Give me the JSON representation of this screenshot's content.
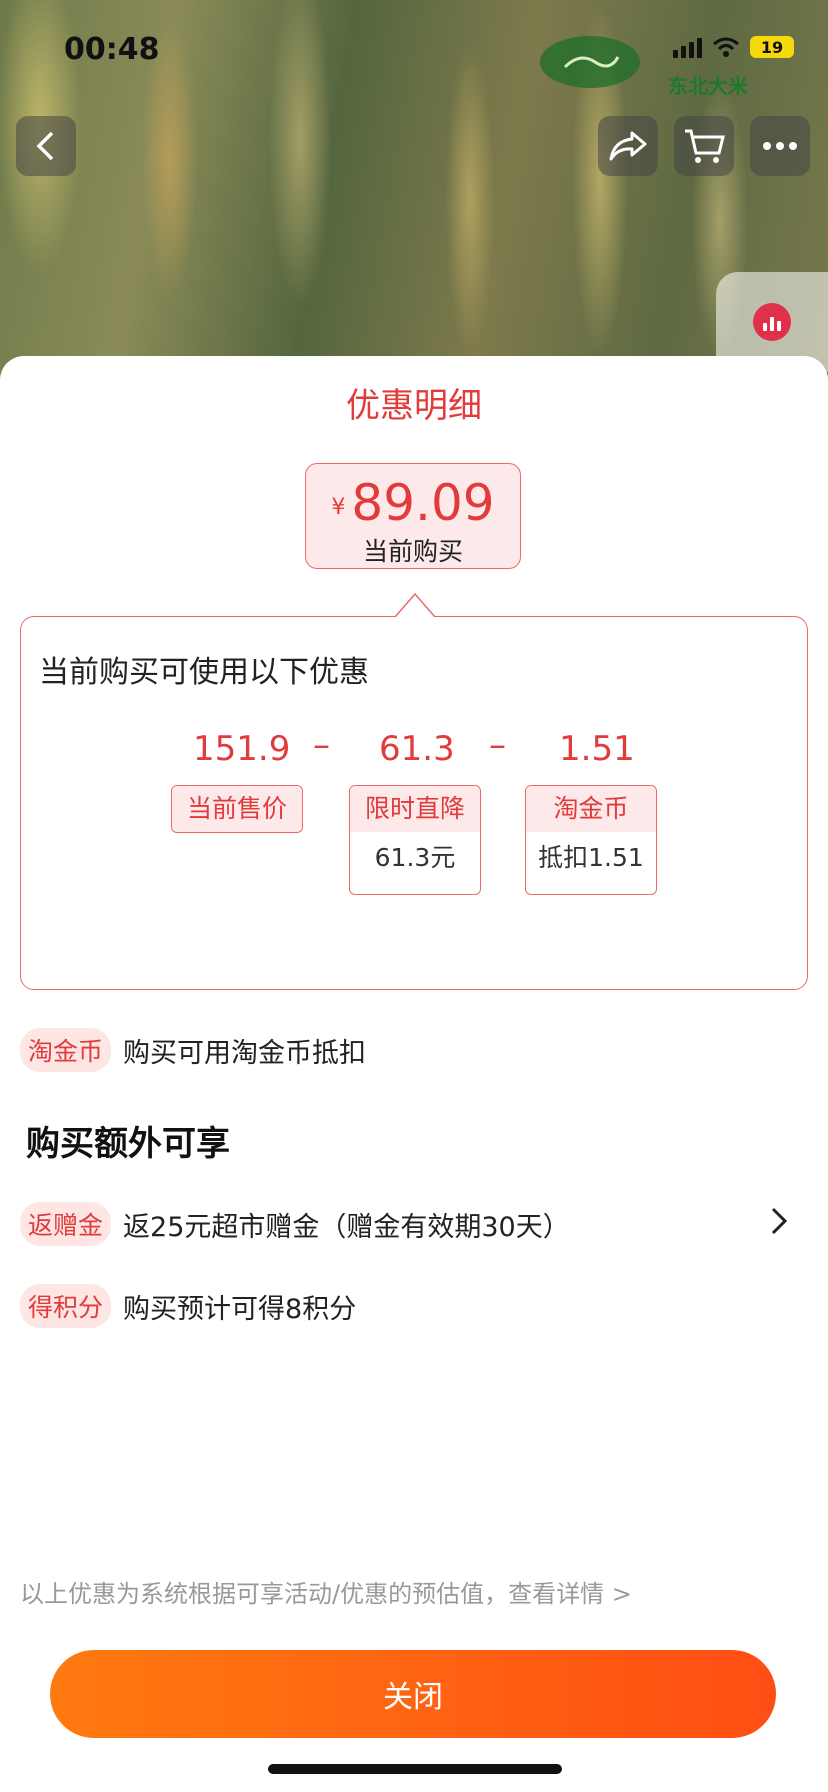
{
  "status_bar": {
    "time": "00:48",
    "battery": "19"
  },
  "brand": {
    "logo_text": "东北大米"
  },
  "sheet": {
    "title": "优惠明细",
    "price": {
      "currency": "¥",
      "value": "89.09",
      "label": "当前购买"
    },
    "promo": {
      "heading": "当前购买可使用以下优惠",
      "original_price": "151.9",
      "discount": "61.3",
      "coin": "1.51",
      "minus": "–",
      "tags": {
        "price_label": "当前售价",
        "discount_label": "限时直降",
        "discount_detail": "61.3元",
        "coin_label": "淘金币",
        "coin_detail": "抵扣1.51"
      }
    },
    "coin_row": {
      "pill": "淘金币",
      "text": "购买可用淘金币抵扣"
    },
    "extra_title": "购买额外可享",
    "extras": [
      {
        "pill": "返赠金",
        "text": "返25元超市赠金（赠金有效期30天）"
      },
      {
        "pill": "得积分",
        "text": "购买预计可得8积分"
      }
    ],
    "footnote": "以上优惠为系统根据可享活动/优惠的预估值，查看详情 >",
    "close_label": "关闭"
  }
}
